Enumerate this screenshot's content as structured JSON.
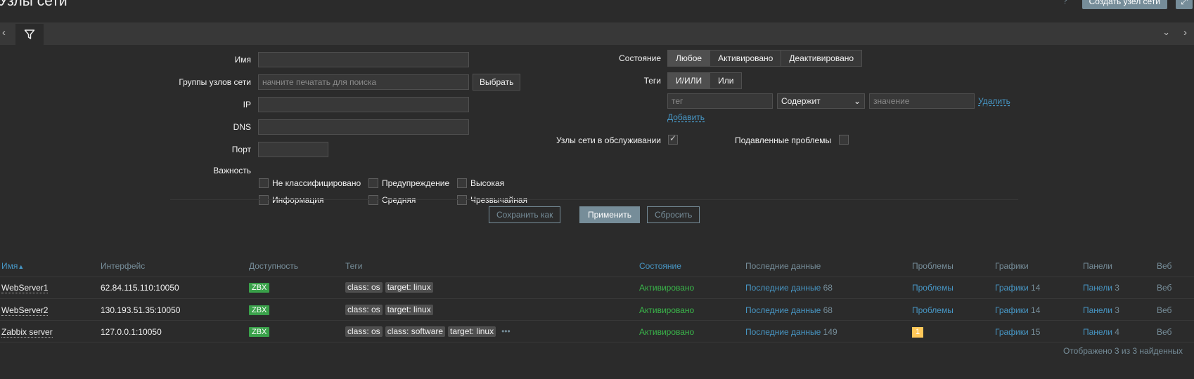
{
  "header": {
    "title": "Узлы сети",
    "help": "?",
    "create_button": "Создать узел сети",
    "kiosk_icon": "expand-icon"
  },
  "filter": {
    "name_label": "Имя",
    "name_value": "",
    "hostgroups_label": "Группы узлов сети",
    "hostgroups_placeholder": "начните печатать для поиска",
    "select_button": "Выбрать",
    "ip_label": "IP",
    "ip_value": "",
    "dns_label": "DNS",
    "dns_value": "",
    "port_label": "Порт",
    "port_value": "",
    "severity_label": "Важность",
    "severities": [
      "Не классифицировано",
      "Предупреждение",
      "Высокая",
      "Информация",
      "Средняя",
      "Чрезвычайная"
    ],
    "status_label": "Состояние",
    "status_options": [
      "Любое",
      "Активировано",
      "Деактивировано"
    ],
    "status_selected": "Любое",
    "tags_label": "Теги",
    "tags_options": [
      "И/ИЛИ",
      "Или"
    ],
    "tags_selected": "И/ИЛИ",
    "tag_placeholder": "тег",
    "tag_operator": "Содержит",
    "tag_value_placeholder": "значение",
    "remove_link": "Удалить",
    "add_link": "Добавить",
    "maintenance_label": "Узлы сети в обслуживании",
    "maintenance_checked": true,
    "suppressed_label": "Подавленные проблемы",
    "suppressed_checked": false,
    "save_as_button": "Сохранить как",
    "apply_button": "Применить",
    "reset_button": "Сбросить"
  },
  "table": {
    "columns": {
      "name": "Имя",
      "name_sort": "▲",
      "interface": "Интерфейс",
      "availability": "Доступность",
      "tags": "Теги",
      "status": "Состояние",
      "latest_data": "Последние данные",
      "problems": "Проблемы",
      "graphs": "Графики",
      "dashboards": "Панели",
      "web": "Веб"
    },
    "rows": [
      {
        "name": "WebServer1",
        "interface": "62.84.115.110:10050",
        "availability": "ZBX",
        "tags": [
          "class: os",
          "target: linux"
        ],
        "status": "Активировано",
        "latest_data": "Последние данные",
        "latest_count": "68",
        "problems": "Проблемы",
        "graphs": "Графики",
        "graphs_count": "14",
        "dashboards": "Панели",
        "dashboards_count": "3",
        "web": "Веб"
      },
      {
        "name": "WebServer2",
        "interface": "130.193.51.35:10050",
        "availability": "ZBX",
        "tags": [
          "class: os",
          "target: linux"
        ],
        "status": "Активировано",
        "latest_data": "Последние данные",
        "latest_count": "68",
        "problems": "Проблемы",
        "graphs": "Графики",
        "graphs_count": "14",
        "dashboards": "Панели",
        "dashboards_count": "3",
        "web": "Веб"
      },
      {
        "name": "Zabbix server",
        "interface": "127.0.0.1:10050",
        "availability": "ZBX",
        "tags": [
          "class: os",
          "class: software",
          "target: linux"
        ],
        "more": "•••",
        "status": "Активировано",
        "latest_data": "Последние данные",
        "latest_count": "149",
        "problems_badge": "1",
        "graphs": "Графики",
        "graphs_count": "15",
        "dashboards": "Панели",
        "dashboards_count": "4",
        "web": "Веб"
      }
    ],
    "footer": "Отображено 3 из 3 найденных"
  },
  "colors": {
    "background": "#2b2b2b",
    "panel": "#383838",
    "accent": "#768d99",
    "link": "#4796c4",
    "enabled": "#3ab54a",
    "zbx_badge": "#3aa14a",
    "warning": "#ffc859"
  }
}
